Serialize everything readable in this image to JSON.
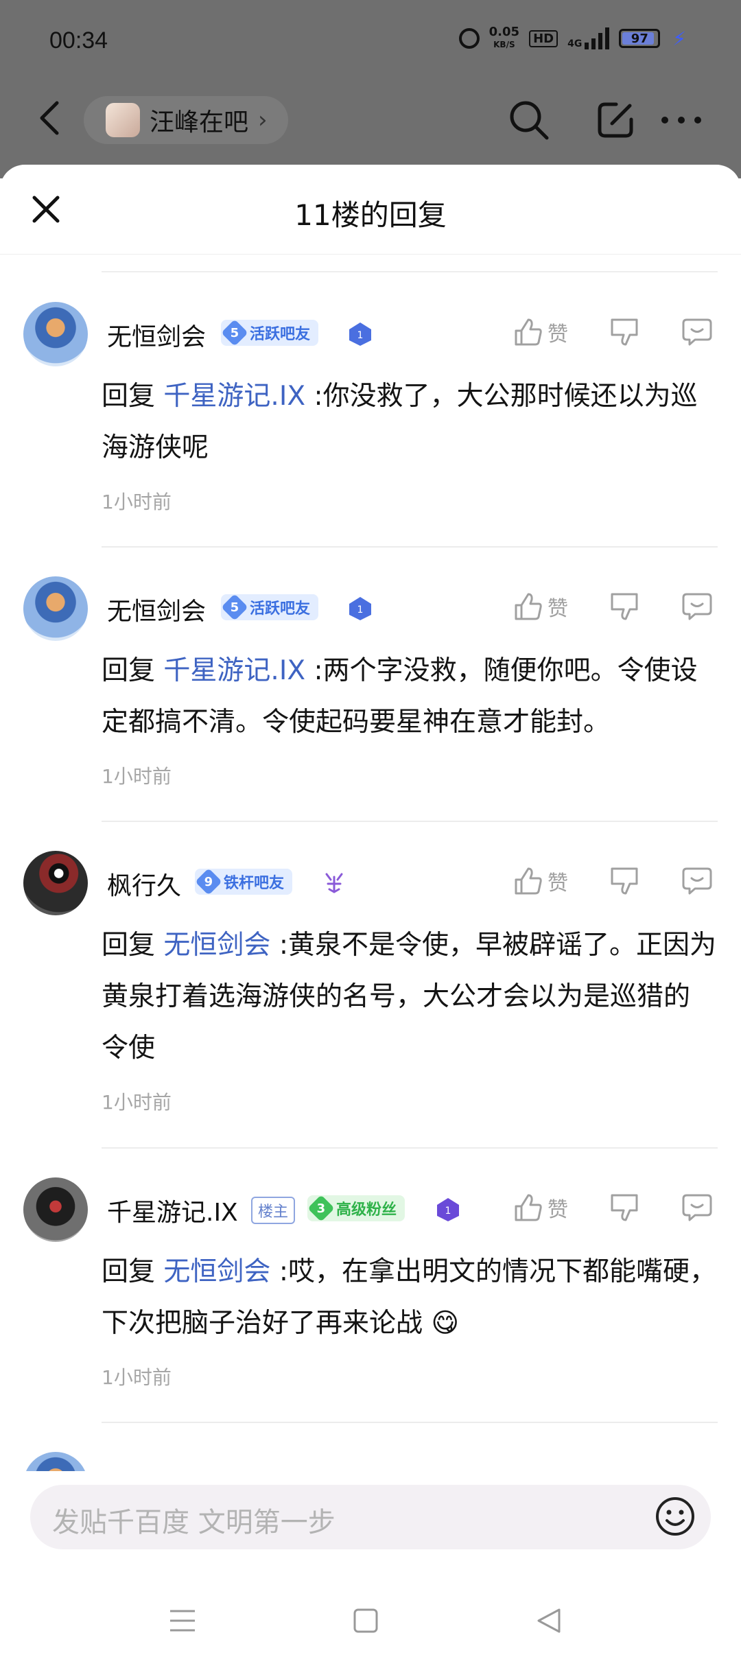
{
  "status_bar": {
    "time": "00:34",
    "net_speed_value": "0.05",
    "net_speed_unit": "KB/S",
    "hd": "HD",
    "network": "4G",
    "battery": "97"
  },
  "navbar": {
    "forum_name": "汪峰在吧",
    "forum_chevron": "›"
  },
  "sheet": {
    "title": "11楼的回复"
  },
  "replies": [
    {
      "user": "无恒剑会",
      "level": "5",
      "badge": "活跃吧友",
      "like_label": "赞",
      "prefix": "回复",
      "target": "千星游记.IX",
      "text": " :你没救了，大公那时候还以为巡海游侠呢",
      "time": "1小时前"
    },
    {
      "user": "无恒剑会",
      "level": "5",
      "badge": "活跃吧友",
      "like_label": "赞",
      "prefix": "回复",
      "target": "千星游记.IX",
      "text": " :两个字没救，随便你吧。令使设定都搞不清。令使起码要星神在意才能封。",
      "time": "1小时前"
    },
    {
      "user": "枫行久",
      "level": "9",
      "badge": "铁杆吧友",
      "like_label": "赞",
      "prefix": "回复",
      "target": "无恒剑会",
      "text": " :黄泉不是令使，早被辟谣了。正因为黄泉打着选海游侠的名号，大公才会以为是巡猎的令使",
      "time": "1小时前"
    },
    {
      "user": "千星游记.IX",
      "owner_tag": "楼主",
      "level": "3",
      "badge": "高级粉丝",
      "like_label": "赞",
      "prefix": "回复",
      "target": "无恒剑会",
      "text": " :哎，在拿出明文的情况下都能嘴硬，下次把脑子治好了再来论战 😋",
      "time": "1小时前"
    }
  ],
  "input": {
    "placeholder": "发贴千百度 文明第一步"
  },
  "colors": {
    "link": "#3e63c2",
    "badge_blue": "#3b6fe0",
    "badge_green": "#2fb24a",
    "overlay": "#6f6f6f"
  }
}
